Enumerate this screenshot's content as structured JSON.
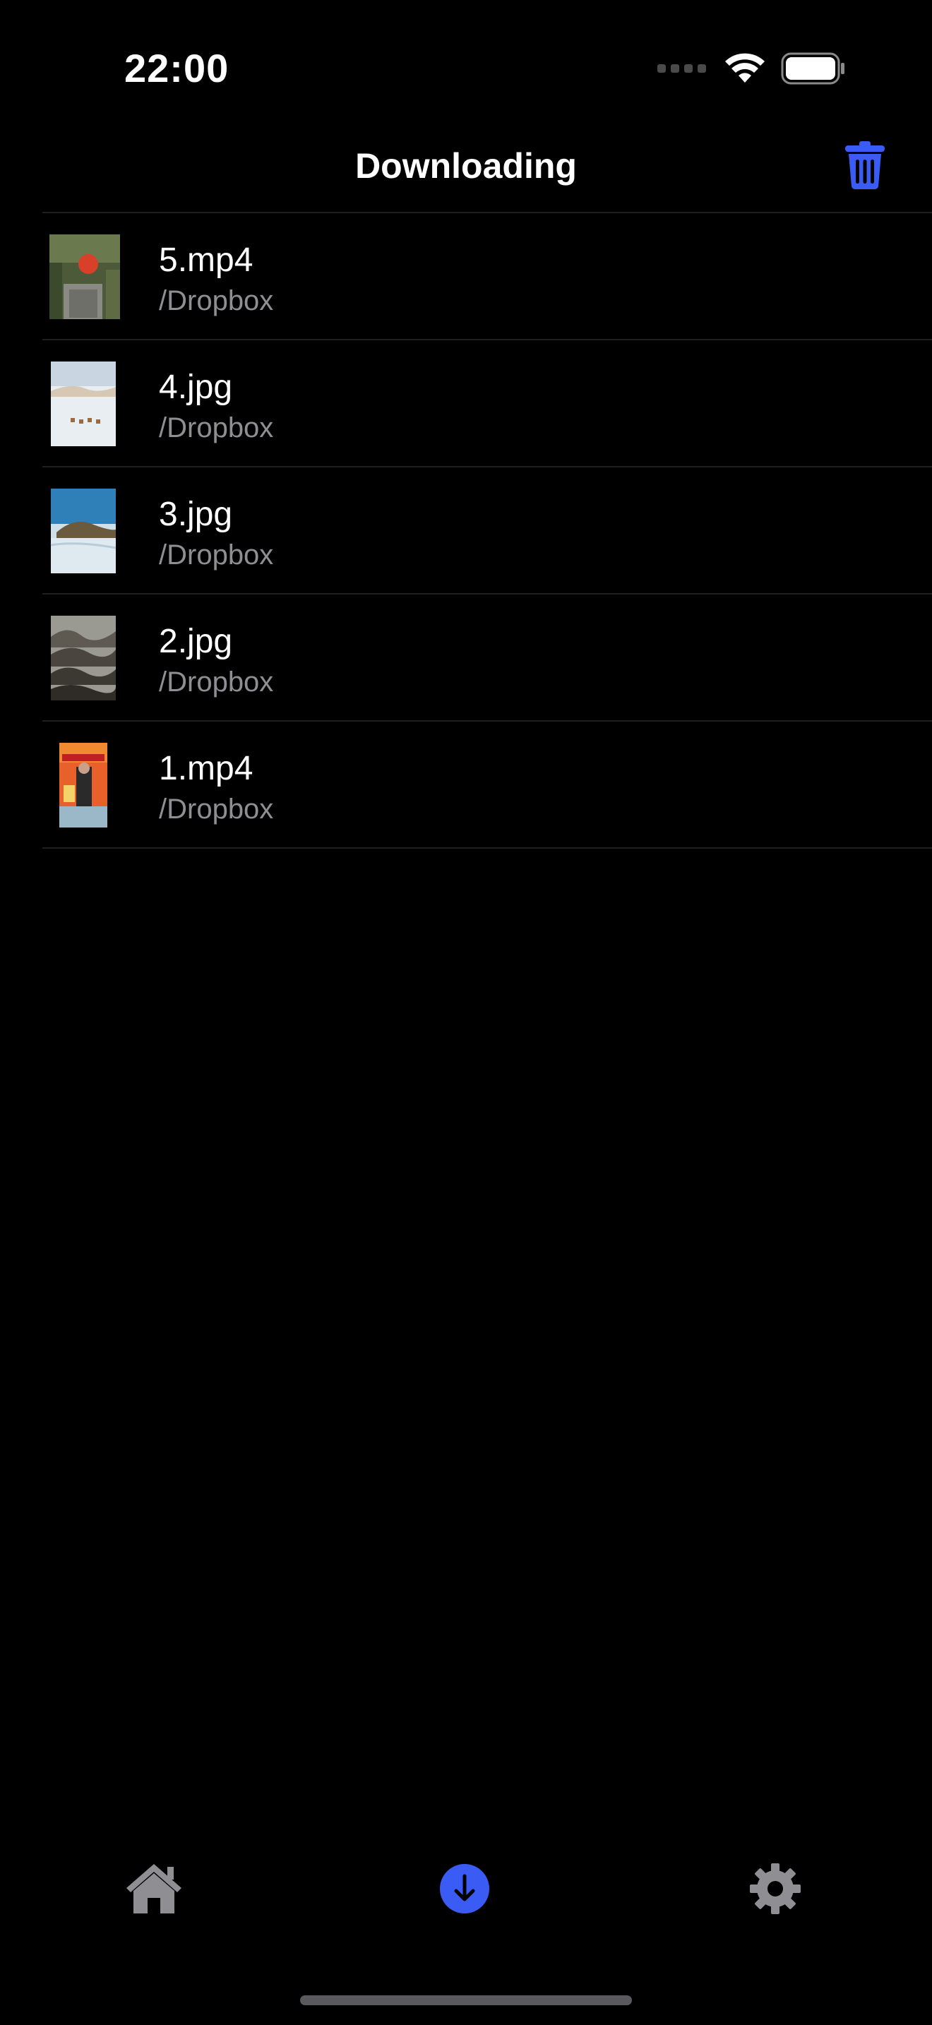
{
  "status_bar": {
    "time": "22:00"
  },
  "nav": {
    "title": "Downloading"
  },
  "files": [
    {
      "name": "5.mp4",
      "path": "/Dropbox",
      "thumbnail": "video-thumb-garden"
    },
    {
      "name": "4.jpg",
      "path": "/Dropbox",
      "thumbnail": "photo-thumb-desert-camels"
    },
    {
      "name": "3.jpg",
      "path": "/Dropbox",
      "thumbnail": "photo-thumb-island-sea"
    },
    {
      "name": "2.jpg",
      "path": "/Dropbox",
      "thumbnail": "photo-thumb-misty-mountains"
    },
    {
      "name": "1.mp4",
      "path": "/Dropbox",
      "thumbnail": "video-thumb-hotpot-poster"
    }
  ],
  "tab_bar": {
    "tabs": [
      {
        "id": "home",
        "icon": "house-icon",
        "active": false
      },
      {
        "id": "downloads",
        "icon": "download-circle-icon",
        "active": true
      },
      {
        "id": "settings",
        "icon": "gear-icon",
        "active": false
      }
    ]
  },
  "colors": {
    "background": "#000000",
    "accent": "#3a5cf5",
    "text_primary": "#ffffff",
    "text_secondary": "#8e8e93",
    "separator": "#1f1f1f",
    "inactive_icon": "#8e8e93"
  }
}
